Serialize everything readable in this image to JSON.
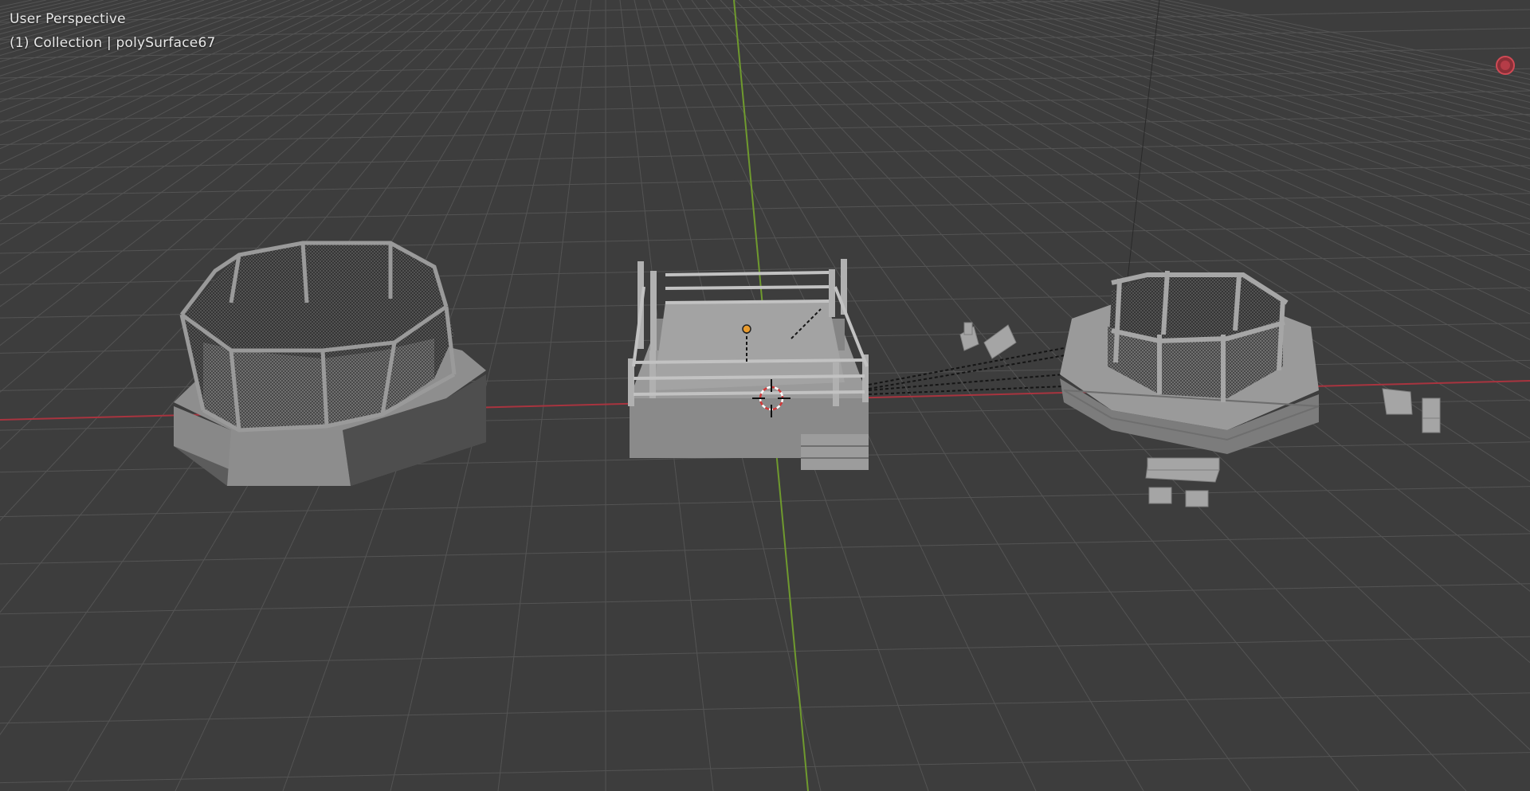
{
  "viewport": {
    "view_name": "User Perspective",
    "context_label": "(1) Collection | polySurface67",
    "axis_colors": {
      "x_axis": "#a8343f",
      "y_axis": "#6f9a2e",
      "grid": "#4f4f4f",
      "background": "#3d3d3d"
    },
    "record_button_color": "#d04a55"
  },
  "scene": {
    "objects": [
      {
        "name": "octagon-cage-left",
        "icon": "mesh-object"
      },
      {
        "name": "boxing-ring-center",
        "icon": "mesh-object"
      },
      {
        "name": "octagon-cage-right",
        "icon": "mesh-object"
      },
      {
        "name": "chairs-and-tables",
        "icon": "mesh-object"
      },
      {
        "name": "3d-cursor",
        "icon": "cursor-icon"
      },
      {
        "name": "light-object",
        "icon": "light-icon"
      }
    ]
  }
}
